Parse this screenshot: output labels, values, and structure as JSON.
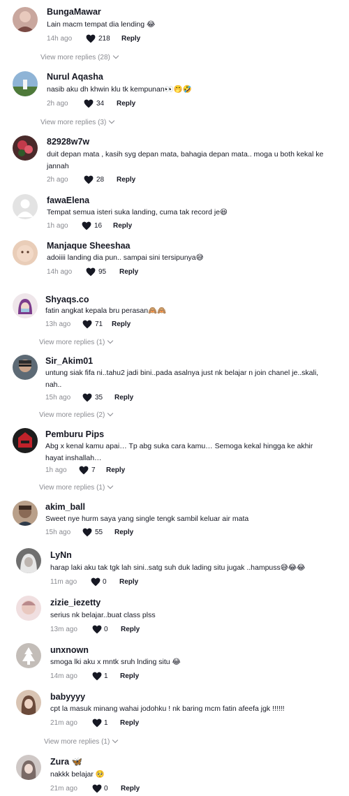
{
  "comments": [
    {
      "username": "BungaMawar",
      "text": "Lain macm tempat dia lending 😂",
      "time": "14h ago",
      "likes": "218",
      "reply": "Reply",
      "view_more": "View more replies (28)",
      "avatar": {
        "bg": "#c9a79e",
        "fg": "#7a4a44"
      }
    },
    {
      "username": "Nurul Aqasha",
      "text": "nasib aku dh khwin klu tk kempunan👀🤭🤣",
      "time": "2h ago",
      "likes": "34",
      "reply": "Reply",
      "view_more": "View more replies (3)",
      "avatar": {
        "bg": "#8fb4d6",
        "fg": "#4f7a3a"
      }
    },
    {
      "username": "82928w7w",
      "text": "duit depan mata , kasih syg depan mata, bahagia depan mata.. moga u both kekal ke jannah",
      "time": "2h ago",
      "likes": "28",
      "reply": "Reply",
      "view_more": "",
      "avatar": {
        "bg": "#4a2a2a",
        "fg": "#c23a4a"
      }
    },
    {
      "username": "fawaElena",
      "text": "Tempat semua isteri suka landing, cuma tak record je😆",
      "time": "1h ago",
      "likes": "16",
      "reply": "Reply",
      "view_more": "",
      "avatar": {
        "bg": "#e3e3e3",
        "fg": "#ffffff"
      }
    },
    {
      "username": "Manjaque Sheeshaa",
      "text": "adoiiii landing dia pun.. sampai sini tersipunya😅",
      "time": "14h ago",
      "likes": "95",
      "reply": "Reply",
      "view_more": "",
      "avatar": {
        "bg": "#e9cdb8",
        "fg": "#c79a86"
      }
    },
    {
      "username": "Shyaqs.co",
      "text": "fatin angkat kepala bru perasan🙈🙈",
      "time": "13h ago",
      "likes": "71",
      "reply": "Reply",
      "view_more": "View more replies (1)",
      "avatar": {
        "bg": "#efe6ea",
        "fg": "#7b3b8c"
      }
    },
    {
      "username": "Sir_Akim01",
      "text": "untung siak fifa ni..tahu2 jadi bini..pada asalnya just nk belajar n join chanel je..skali, nah..",
      "time": "15h ago",
      "likes": "35",
      "reply": "Reply",
      "view_more": "View more replies (2)",
      "avatar": {
        "bg": "#5d6a75",
        "fg": "#2c2c2c"
      }
    },
    {
      "username": "Pemburu Pips",
      "text": "Abg x kenal kamu apai… Tp abg suka cara kamu… Semoga kekal hingga ke akhir hayat inshallah…",
      "time": "1h ago",
      "likes": "7",
      "reply": "Reply",
      "view_more": "View more replies (1)",
      "avatar": {
        "bg": "#1d1d1d",
        "fg": "#c0222a"
      }
    },
    {
      "username": "akim_ball",
      "text": "Sweet nye hurm saya yang single tengk sambil keluar air mata",
      "time": "15h ago",
      "likes": "55",
      "reply": "Reply",
      "view_more": "",
      "avatar": {
        "bg": "#b9a08a",
        "fg": "#3d2b22"
      }
    },
    {
      "username": "LyNn",
      "text": "harap laki aku tak tgk lah sini..satg suh duk lading situ jugak ..hampuss😅😂😂",
      "time": "11m ago",
      "likes": "0",
      "reply": "Reply",
      "view_more": "",
      "avatar": {
        "bg": "#6f6f6f",
        "fg": "#e7e7e7"
      }
    },
    {
      "username": "zizie_iezetty",
      "text": "serius nk belajar..buat class plss",
      "time": "13m ago",
      "likes": "0",
      "reply": "Reply",
      "view_more": "",
      "avatar": {
        "bg": "#f0dfe0",
        "fg": "#b98a8c"
      }
    },
    {
      "username": "unxnown",
      "text": "smoga lki aku x mntk sruh lnding situ 😂",
      "time": "14m ago",
      "likes": "1",
      "reply": "Reply",
      "view_more": "",
      "avatar": {
        "bg": "#c3bdb8",
        "fg": "#ffffff"
      }
    },
    {
      "username": "babyyyy",
      "text": "cpt la masuk minang wahai jodohku ! nk baring mcm fatin afeefa jgk !!!!!!",
      "time": "21m ago",
      "likes": "1",
      "reply": "Reply",
      "view_more": "View more replies (1)",
      "avatar": {
        "bg": "#d9c4b3",
        "fg": "#6b4a3a"
      }
    },
    {
      "username": "Zura 🦋",
      "text": "nakkk belajar 🥺",
      "time": "21m ago",
      "likes": "0",
      "reply": "Reply",
      "view_more": "",
      "avatar": {
        "bg": "#cfc8c6",
        "fg": "#7a6a66"
      }
    }
  ],
  "colors": {
    "primary_text": "#161823",
    "secondary_text": "#8a8b91",
    "heart": "#161823"
  }
}
